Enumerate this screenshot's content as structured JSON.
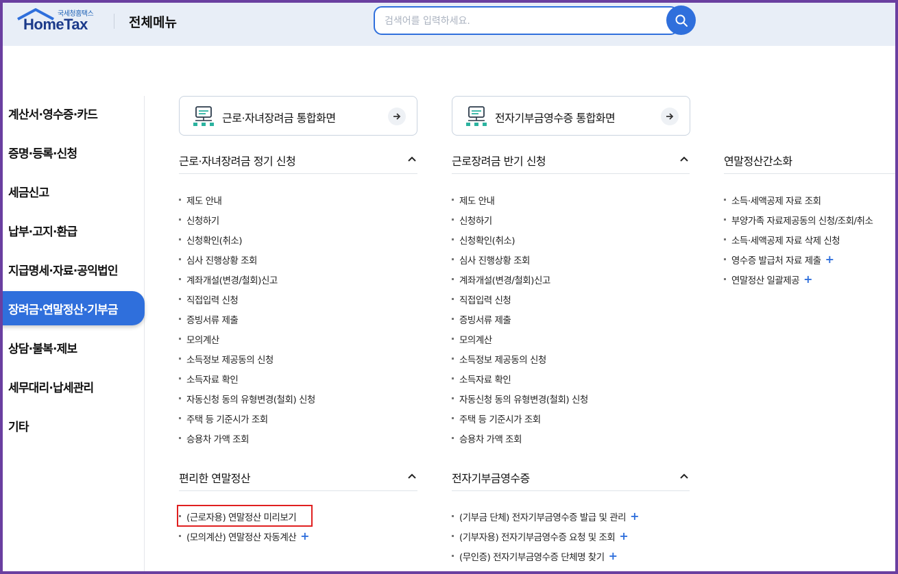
{
  "header": {
    "logo_small": "국세청홈택스",
    "logo_main": "HomeTax",
    "title": "전체메뉴",
    "search_placeholder": "검색어를 입력하세요."
  },
  "sidebar": {
    "items": [
      {
        "label": "계산서·영수증·카드"
      },
      {
        "label": "증명·등록·신청"
      },
      {
        "label": "세금신고"
      },
      {
        "label": "납부·고지·환급"
      },
      {
        "label": "지급명세·자료·공익법인"
      },
      {
        "label": "장려금·연말정산·기부금",
        "active": true
      },
      {
        "label": "상담·불복·제보"
      },
      {
        "label": "세무대리·납세관리"
      },
      {
        "label": "기타"
      }
    ]
  },
  "cards": [
    {
      "label": "근로·자녀장려금 통합화면"
    },
    {
      "label": "전자기부금영수증 통합화면"
    }
  ],
  "sections": {
    "col1_top": {
      "title": "근로·자녀장려금 정기 신청",
      "items": [
        "제도 안내",
        "신청하기",
        "신청확인(취소)",
        "심사 진행상황 조회",
        "계좌개설(변경/철회)신고",
        "직접입력 신청",
        "증빙서류 제출",
        "모의계산",
        "소득정보 제공동의 신청",
        "소득자료 확인",
        "자동신청 동의 유형변경(철회) 신청",
        "주택 등 기준시가 조회",
        "승용차 가액 조회"
      ]
    },
    "col2_top": {
      "title": "근로장려금 반기 신청",
      "items": [
        "제도 안내",
        "신청하기",
        "신청확인(취소)",
        "심사 진행상황 조회",
        "계좌개설(변경/철회)신고",
        "직접입력 신청",
        "증빙서류 제출",
        "모의계산",
        "소득정보 제공동의 신청",
        "소득자료 확인",
        "자동신청 동의 유형변경(철회) 신청",
        "주택 등 기준시가 조회",
        "승용차 가액 조회"
      ]
    },
    "col3_top": {
      "title": "연말정산간소화",
      "items": [
        "소득·세액공제 자료 조회",
        "부양가족 자료제공동의 신청/조회/취소",
        "소득·세액공제 자료 삭제 신청",
        "영수증 발급처 자료 제출",
        "연말정산 일괄제공"
      ]
    },
    "col1_bottom": {
      "title": "편리한 연말정산",
      "items": [
        "(근로자용) 연말정산 미리보기",
        "(모의계산) 연말정산 자동계산"
      ]
    },
    "col2_bottom": {
      "title": "전자기부금영수증",
      "items": [
        "(기부금 단체) 전자기부금영수증 발급 및 관리",
        "(기부자용) 전자기부금영수증 요청 및 조회",
        "(무인증) 전자기부금영수증 단체명 찾기"
      ]
    },
    "plus_mark": "+"
  },
  "colors": {
    "accent": "#2f6fdc",
    "highlight_border": "#e01f1f",
    "frame": "#6a3fa0"
  }
}
